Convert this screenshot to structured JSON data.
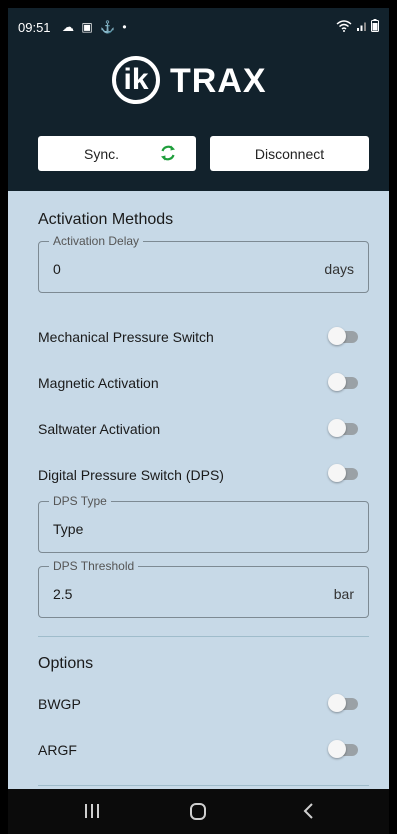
{
  "status_bar": {
    "time": "09:51",
    "icons_left": [
      "cloud-icon",
      "image-icon",
      "usb-icon",
      "dot-icon"
    ],
    "icons_right": [
      "wifi-icon",
      "signal-icon",
      "battery-icon"
    ]
  },
  "brand": {
    "mark": "ik",
    "name": "TRAX"
  },
  "toolbar": {
    "sync_label": "Sync.",
    "disconnect_label": "Disconnect",
    "sync_icon_color": "#1e9e3b"
  },
  "activation": {
    "title": "Activation Methods",
    "delay": {
      "label": "Activation Delay",
      "value": "0",
      "unit": "days"
    },
    "switches": [
      {
        "label": "Mechanical Pressure Switch",
        "on": false
      },
      {
        "label": "Magnetic Activation",
        "on": false
      },
      {
        "label": "Saltwater Activation",
        "on": false
      },
      {
        "label": "Digital Pressure Switch (DPS)",
        "on": false
      }
    ],
    "dps_type": {
      "label": "DPS Type",
      "value": "Type"
    },
    "dps_threshold": {
      "label": "DPS Threshold",
      "value": "2.5",
      "unit": "bar"
    }
  },
  "options": {
    "title": "Options",
    "switches": [
      {
        "label": "BWGP",
        "on": false
      },
      {
        "label": "ARGF",
        "on": false
      }
    ]
  },
  "nav": {
    "buttons": [
      "recent-apps-icon",
      "home-icon",
      "back-icon"
    ]
  },
  "colors": {
    "header_bg": "#12222c",
    "content_bg": "#c7d9e7",
    "toggle_off_track": "#9aa1a6"
  }
}
